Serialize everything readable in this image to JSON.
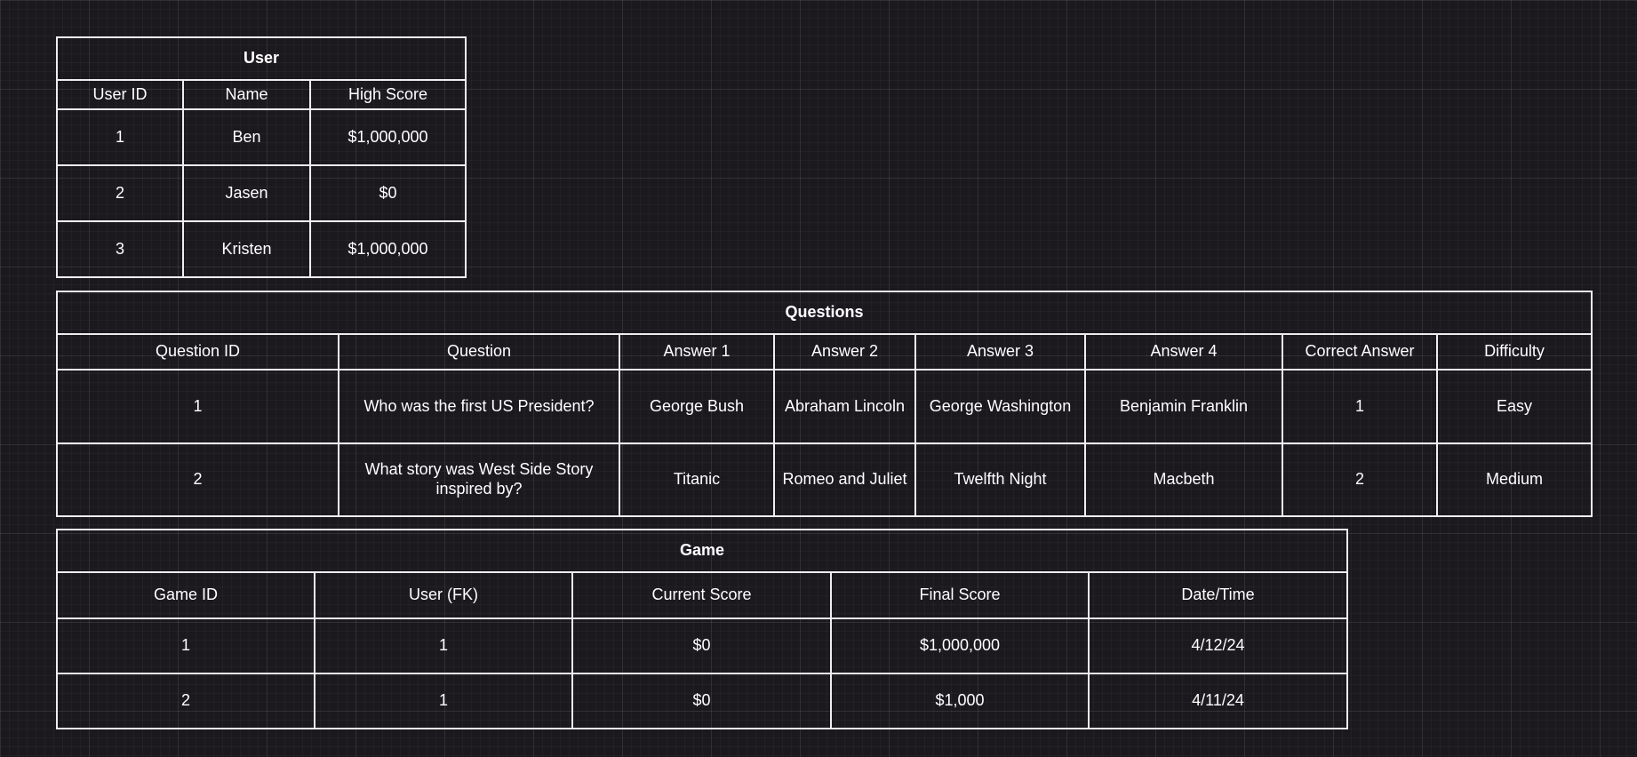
{
  "user_table": {
    "title": "User",
    "columns": [
      "User ID",
      "Name",
      "High Score"
    ],
    "rows": [
      [
        "1",
        "Ben",
        "$1,000,000"
      ],
      [
        "2",
        "Jasen",
        "$0"
      ],
      [
        "3",
        "Kristen",
        "$1,000,000"
      ]
    ]
  },
  "questions_table": {
    "title": "Questions",
    "columns": [
      "Question ID",
      "Question",
      "Answer 1",
      "Answer 2",
      "Answer 3",
      "Answer 4",
      "Correct Answer",
      "Difficulty"
    ],
    "rows": [
      [
        "1",
        "Who was the first US President?",
        "George Bush",
        "Abraham Lincoln",
        "George Washington",
        "Benjamin Franklin",
        "1",
        "Easy"
      ],
      [
        "2",
        "What story was West Side Story inspired by?",
        "Titanic",
        "Romeo and Juliet",
        "Twelfth Night",
        "Macbeth",
        "2",
        "Medium"
      ]
    ]
  },
  "game_table": {
    "title": "Game",
    "columns": [
      "Game ID",
      "User (FK)",
      "Current Score",
      "Final Score",
      "Date/Time"
    ],
    "rows": [
      [
        "1",
        "1",
        "$0",
        "$1,000,000",
        "4/12/24"
      ],
      [
        "2",
        "1",
        "$0",
        "$1,000",
        "4/11/24"
      ]
    ]
  }
}
